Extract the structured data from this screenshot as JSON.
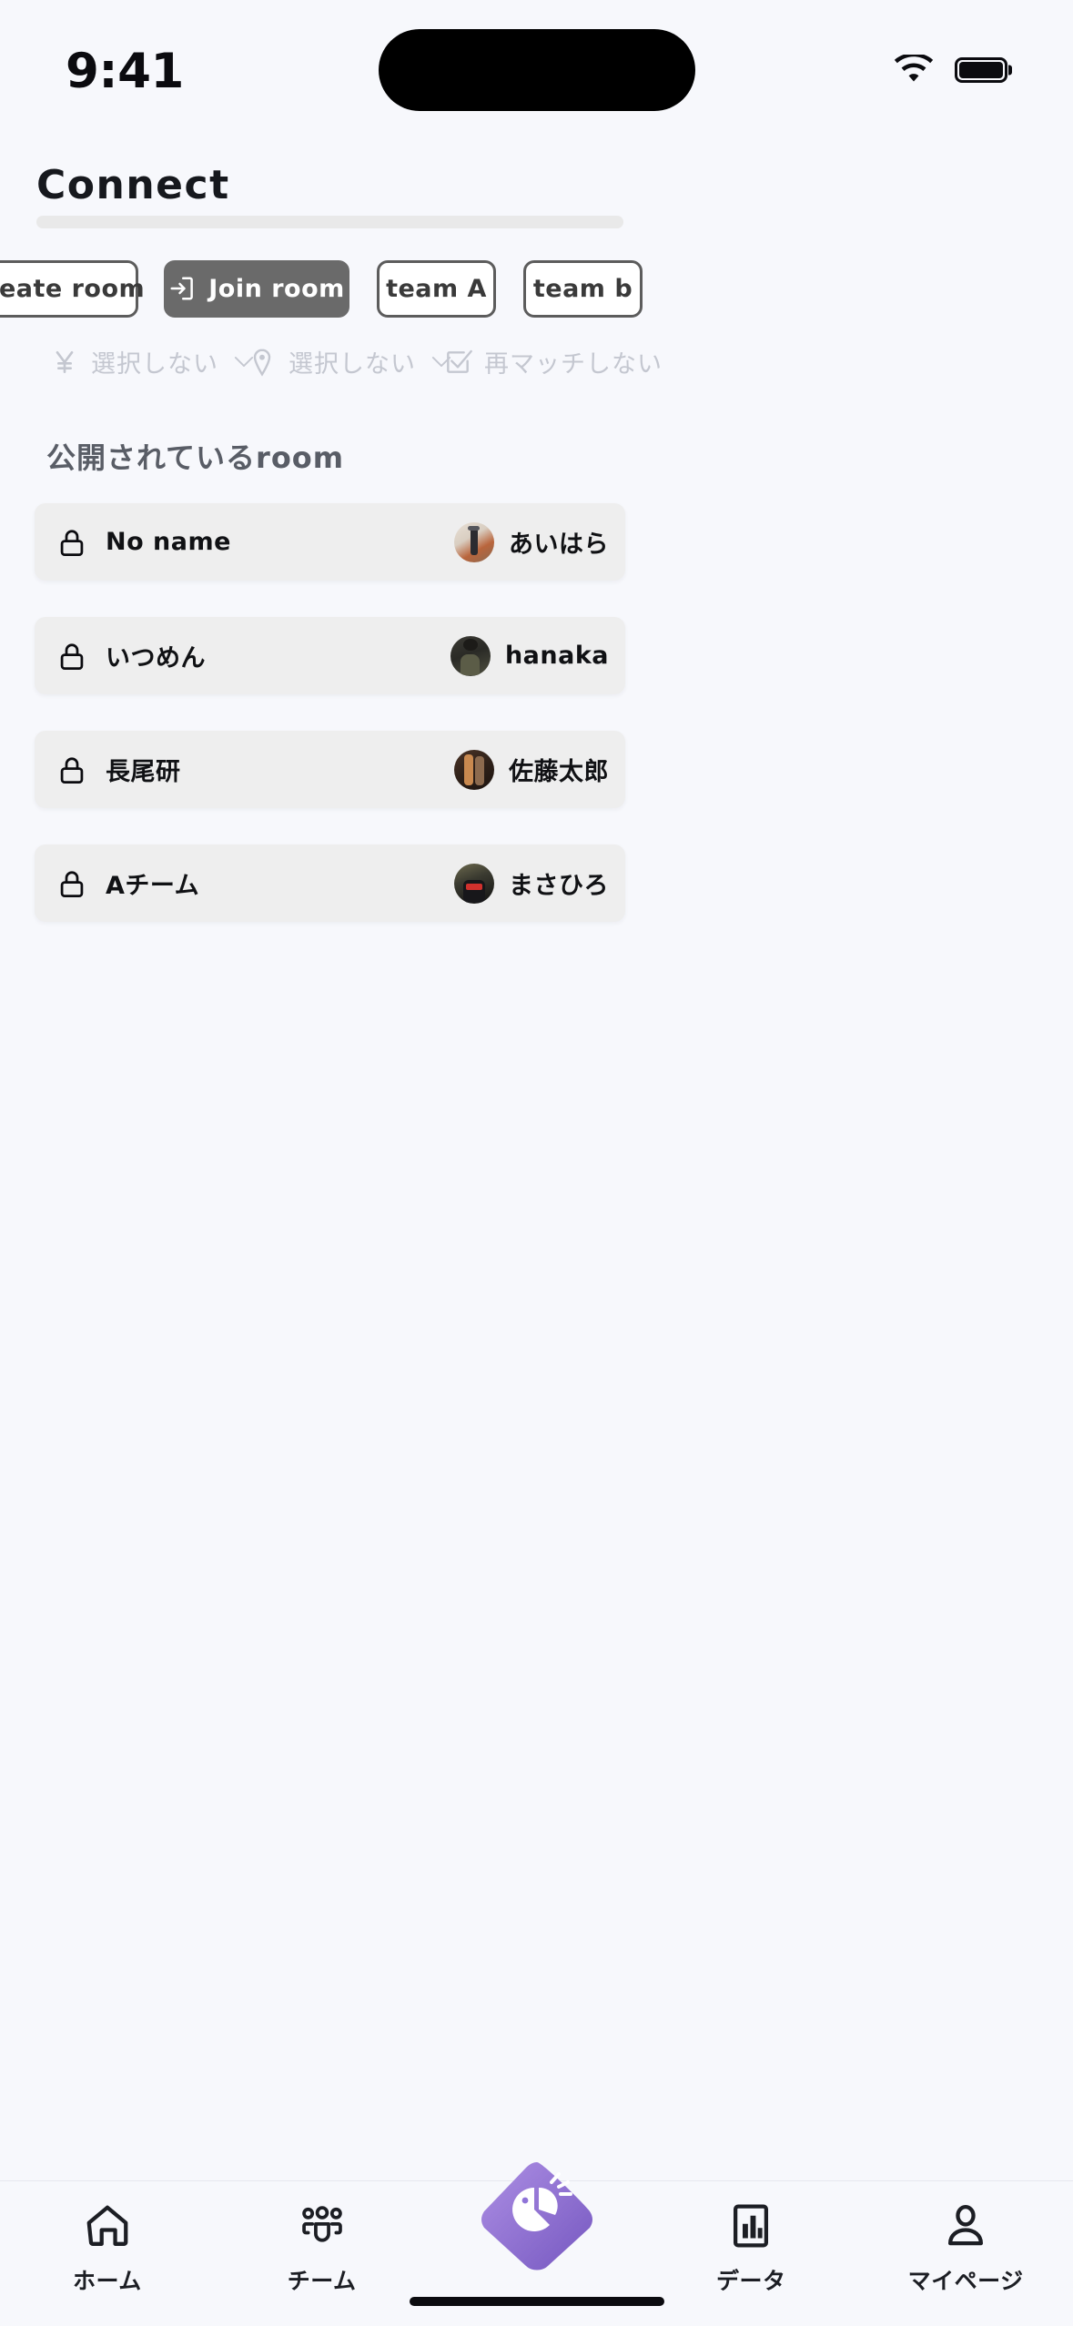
{
  "status_bar": {
    "time": "9:41",
    "wifi_icon": "wifi-icon",
    "battery_icon": "battery-icon"
  },
  "header": {
    "title": "Connect"
  },
  "tabs": [
    {
      "label": "Create room",
      "active": false,
      "icon": null
    },
    {
      "label": "Join room",
      "active": true,
      "icon": "enter-door-icon"
    },
    {
      "label": "team A",
      "active": false,
      "icon": null
    },
    {
      "label": "team b",
      "active": false,
      "icon": null
    }
  ],
  "filters": [
    {
      "icon": "yen-icon",
      "label": "選択しない",
      "has_chevron": true
    },
    {
      "icon": "location-pin-icon",
      "label": "選択しない",
      "has_chevron": true
    },
    {
      "icon": "checkbox-checked-icon",
      "label": "再マッチしない",
      "has_chevron": false
    }
  ],
  "section": {
    "title": "公開されているroom"
  },
  "rooms": [
    {
      "lock_icon": "lock-icon",
      "name": "No name",
      "owner": "あいはら",
      "avatar": "avatar-aihara"
    },
    {
      "lock_icon": "lock-icon",
      "name": "いつめん",
      "owner": "hanaka",
      "avatar": "avatar-hanaka"
    },
    {
      "lock_icon": "lock-icon",
      "name": "長尾研",
      "owner": "佐藤太郎",
      "avatar": "avatar-sato"
    },
    {
      "lock_icon": "lock-icon",
      "name": "Aチーム",
      "owner": "まさひろ",
      "avatar": "avatar-masahiro"
    }
  ],
  "bottom_nav": {
    "items": [
      {
        "label": "ホーム",
        "icon": "home-icon"
      },
      {
        "label": "チーム",
        "icon": "group-people-icon"
      },
      {
        "label": "データ",
        "icon": "bar-chart-icon"
      },
      {
        "label": "マイページ",
        "icon": "person-icon"
      }
    ],
    "fab": {
      "icon": "pie-chart-marker-icon"
    }
  },
  "colors": {
    "background": "#f7f8fc",
    "card": "#eeeeee",
    "active_tab": "#6a6a6a",
    "tab_border": "#5c5c5c",
    "filter_text": "#c4c7d0",
    "section_text": "#595d66",
    "fab_purple_light": "#a98ae0",
    "fab_purple_dark": "#7b5cc4"
  }
}
